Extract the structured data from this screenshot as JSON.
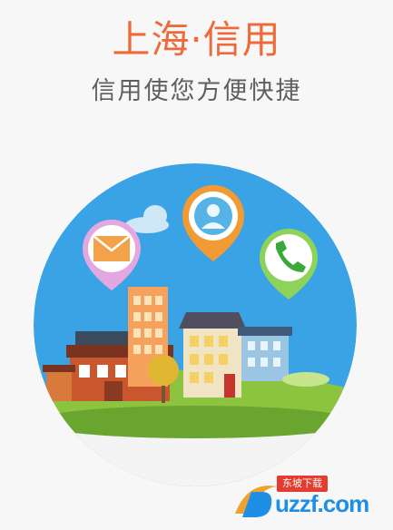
{
  "header": {
    "title": "上海·信用",
    "subtitle": "信用使您方便快捷"
  },
  "illustration": {
    "icons": [
      "mail-icon",
      "contact-icon",
      "phone-icon"
    ]
  },
  "watermark": {
    "chip": "东坡下载",
    "domain": "uzzf.com"
  }
}
